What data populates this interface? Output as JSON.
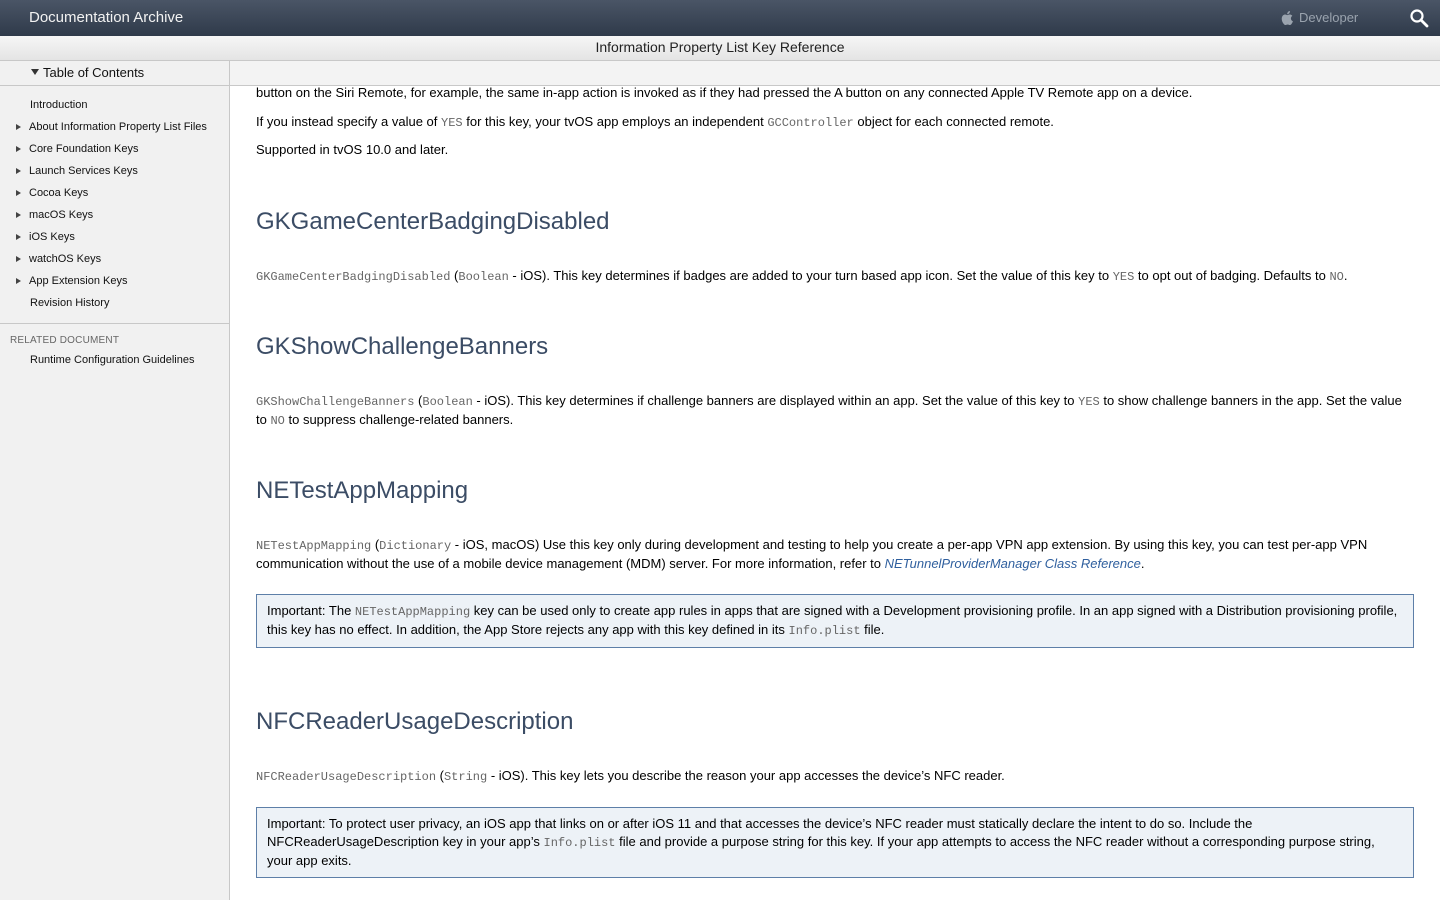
{
  "topbar": {
    "brand": "Documentation Archive",
    "developer": "Developer"
  },
  "title": "Information Property List Key Reference",
  "sidebar": {
    "toc_label": "Table of Contents",
    "items": [
      {
        "label": "Introduction",
        "expandable": false
      },
      {
        "label": "About Information Property List Files",
        "expandable": true
      },
      {
        "label": "Core Foundation Keys",
        "expandable": true
      },
      {
        "label": "Launch Services Keys",
        "expandable": true
      },
      {
        "label": "Cocoa Keys",
        "expandable": true
      },
      {
        "label": "macOS Keys",
        "expandable": true
      },
      {
        "label": "iOS Keys",
        "expandable": true
      },
      {
        "label": "watchOS Keys",
        "expandable": true
      },
      {
        "label": "App Extension Keys",
        "expandable": true
      },
      {
        "label": "Revision History",
        "expandable": false
      }
    ],
    "related_heading": "RELATED DOCUMENT",
    "related_item": "Runtime Configuration Guidelines"
  },
  "content": {
    "top_para": "button on the Siri Remote, for example, the same in-app action is invoked as if they had pressed the A button on any connected Apple TV Remote app on a device.",
    "yes_para": {
      "a": "If you instead specify a value of ",
      "yes": "YES",
      "b": " for this key, your tvOS app employs an independent ",
      "code": "GCController",
      "c": " object for each connected remote."
    },
    "supported": "Supported in tvOS 10.0 and later.",
    "s1": {
      "heading": "GKGameCenterBadgingDisabled",
      "key": "GKGameCenterBadgingDisabled",
      "type": "Boolean",
      "text1": " - iOS). This key determines if badges are added to your turn based app icon. Set the value of this key to ",
      "yes": "YES",
      "text2": " to opt out of badging. Defaults to ",
      "no": "NO",
      "text3": "."
    },
    "s2": {
      "heading": "GKShowChallengeBanners",
      "key": "GKShowChallengeBanners",
      "type": "Boolean",
      "text1": " - iOS). This key determines if challenge banners are displayed within an app. Set the value of this key to ",
      "yes": "YES",
      "text2": " to show challenge banners in the app. Set the value to ",
      "no": "NO",
      "text3": " to suppress challenge-related banners."
    },
    "s3": {
      "heading": "NETestAppMapping",
      "key": "NETestAppMapping",
      "type": "Dictionary",
      "text1": " - iOS, macOS) Use this key only during development and testing to help you create a per-app VPN app extension. By using this key, you can test per-app VPN communication without the use of a mobile device management (MDM) server. For more information, refer to ",
      "link": "NETunnelProviderManager Class Reference",
      "text2": ".",
      "note": {
        "a": "Important: The ",
        "code": "NETestAppMapping",
        "b": " key can be used only to create app rules in apps that are signed with a Development provisioning profile. In an app signed with a Distribution provisioning profile, this key has no effect. In addition, the App Store rejects any app with this key defined in its ",
        "code2": "Info.plist",
        "c": " file."
      }
    },
    "s4": {
      "heading": "NFCReaderUsageDescription",
      "key": "NFCReaderUsageDescription",
      "type": "String",
      "text1": " - iOS). This key lets you describe the reason your app accesses the device’s NFC reader.",
      "note": {
        "a": "Important: To protect user privacy, an iOS app that links on or after iOS 11 and that accesses the device’s NFC reader must statically declare the intent to do so. Include the NFCReaderUsageDescription key in your app’s ",
        "code": "Info.plist",
        "b": " file and provide a purpose string for this key. If your app attempts to access the NFC reader without a corresponding purpose string, your app exits."
      }
    }
  }
}
